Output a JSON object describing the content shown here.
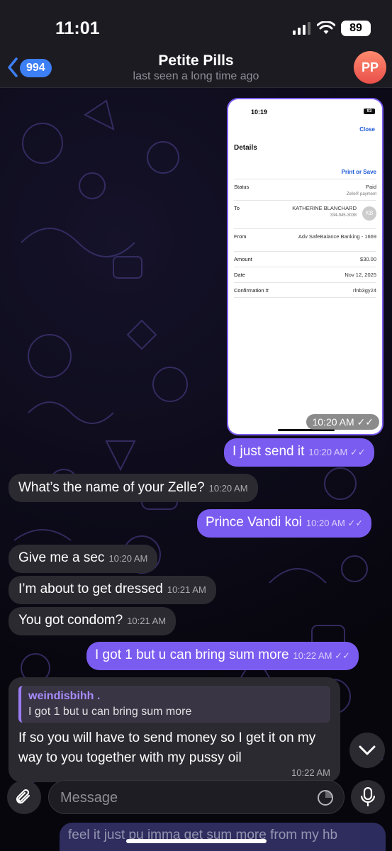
{
  "status_bar": {
    "time": "11:01",
    "battery": "89"
  },
  "header": {
    "back_count": "994",
    "title": "Petite Pills",
    "subtitle": "last seen a long time ago",
    "avatar_initials": "PP"
  },
  "photo": {
    "status_time": "10:19",
    "status_battery": "93",
    "close_label": "Close",
    "title": "Details",
    "print_label": "Print or Save",
    "rows": [
      {
        "label": "Status",
        "value": "Paid",
        "sub": "Zelle® payment"
      },
      {
        "label": "To",
        "value": "KATHERINE BLANCHARD",
        "sub": "334-945-3038",
        "badge": "KB"
      },
      {
        "label": "From",
        "value": "Adv SafeBalance Banking - 1669"
      },
      {
        "label": "Amount",
        "value": "$30.00"
      },
      {
        "label": "Date",
        "value": "Nov 12, 2025"
      },
      {
        "label": "Confirmation #",
        "value": "rlnb3gy24"
      }
    ],
    "time": "10:20 AM"
  },
  "messages": [
    {
      "dir": "out",
      "text": "I just send it",
      "time": "10:20 AM"
    },
    {
      "dir": "in",
      "text": "What’s the name of your Zelle?",
      "time": "10:20 AM"
    },
    {
      "dir": "out",
      "text": "Prince Vandi koi",
      "time": "10:20 AM"
    },
    {
      "dir": "in",
      "text": "Give me a sec",
      "time": "10:20 AM"
    },
    {
      "dir": "in",
      "text": "I’m about to get dressed",
      "time": "10:21 AM"
    },
    {
      "dir": "in",
      "text": "You got condom?",
      "time": "10:21 AM"
    },
    {
      "dir": "out",
      "text": "I got 1 but u can bring sum more",
      "time": "10:22 AM"
    }
  ],
  "reply": {
    "quote_name": "weindisbihh .",
    "quote_text": "I got 1 but u can bring sum more",
    "text": "If so you will have to send money so I get it on my way to you together with my pussy oil",
    "time": "10:22 AM"
  },
  "input": {
    "placeholder": "Message"
  },
  "partial_message": "feel it just pu imma get sum more from my hb",
  "colors": {
    "outgoing": "#7b5cf0",
    "incoming": "#2a2a30",
    "accent": "#3d7ff5"
  }
}
